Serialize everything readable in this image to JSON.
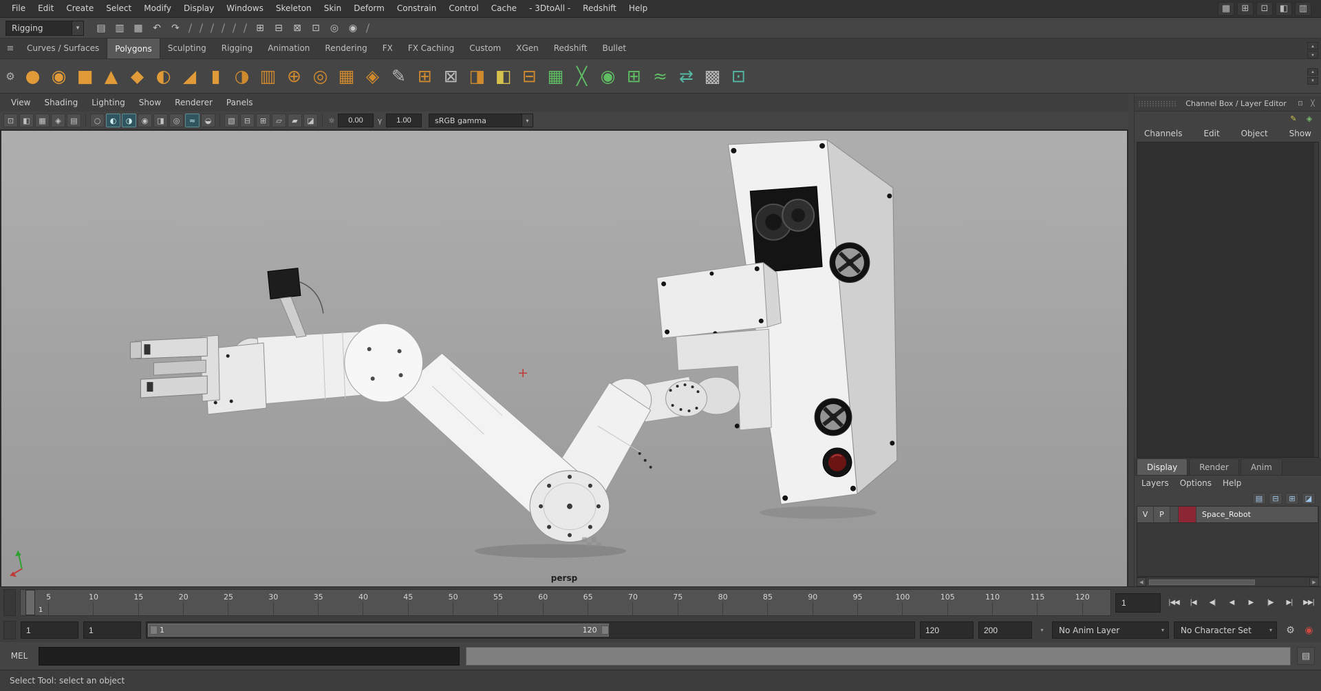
{
  "colors": {
    "shelf_orange": "#e09a38",
    "shelf_green": "#5fbd63",
    "layer_swatch": "#8b2635",
    "viewport_bg": "#a4a4a4",
    "autokey_red": "#cc4842"
  },
  "ui": {
    "chevron_down": "▾",
    "chevron_up": "▴",
    "left_arrow": "◀",
    "right_arrow": "▶",
    "close": "╳",
    "dock": "⊡"
  },
  "menubar": {
    "items": [
      "File",
      "Edit",
      "Create",
      "Select",
      "Modify",
      "Display",
      "Windows",
      "Skeleton",
      "Skin",
      "Deform",
      "Constrain",
      "Control",
      "Cache",
      "- 3DtoAll -",
      "Redshift",
      "Help"
    ],
    "window_icons": [
      {
        "name": "workspace-icon",
        "glyph": "▦"
      },
      {
        "name": "panel-layout-icon",
        "glyph": "⊞"
      },
      {
        "name": "single-pane-icon",
        "glyph": "⊡"
      },
      {
        "name": "outliner-toggle-icon",
        "glyph": "◧"
      },
      {
        "name": "sidebar-toggle-icon",
        "glyph": "▥"
      }
    ]
  },
  "statusline": {
    "menuset": "Rigging",
    "icons": [
      {
        "name": "new-scene-icon",
        "glyph": "▤",
        "kind": "icon"
      },
      {
        "name": "open-scene-icon",
        "glyph": "▥",
        "kind": "icon"
      },
      {
        "name": "save-scene-icon",
        "glyph": "▦",
        "kind": "icon"
      },
      {
        "name": "undo-icon",
        "glyph": "↶",
        "kind": "icon"
      },
      {
        "name": "redo-icon",
        "glyph": "↷",
        "kind": "icon"
      },
      {
        "name": "group-separator",
        "glyph": "∕",
        "kind": "sep"
      },
      {
        "name": "group-separator",
        "glyph": "∕",
        "kind": "sep"
      },
      {
        "name": "group-separator",
        "glyph": "∕",
        "kind": "sep"
      },
      {
        "name": "group-separator",
        "glyph": "∕",
        "kind": "sep"
      },
      {
        "name": "group-separator",
        "glyph": "∕",
        "kind": "sep"
      },
      {
        "name": "group-separator",
        "glyph": "∕",
        "kind": "sep"
      },
      {
        "name": "snap-grid-icon",
        "glyph": "⊞",
        "kind": "icon"
      },
      {
        "name": "snap-curve-icon",
        "glyph": "⊟",
        "kind": "icon"
      },
      {
        "name": "snap-point-icon",
        "glyph": "⊠",
        "kind": "icon"
      },
      {
        "name": "ipr-render-icon",
        "glyph": "⊡",
        "kind": "icon"
      },
      {
        "name": "render-view-icon",
        "glyph": "◎",
        "kind": "icon"
      },
      {
        "name": "render-current-icon",
        "glyph": "◉",
        "kind": "icon"
      },
      {
        "name": "group-separator",
        "glyph": "∕",
        "kind": "sep"
      }
    ]
  },
  "shelf": {
    "tabs": [
      {
        "label": "Curves / Surfaces",
        "state": ""
      },
      {
        "label": "Polygons",
        "state": "active"
      },
      {
        "label": "Sculpting",
        "state": ""
      },
      {
        "label": "Rigging",
        "state": ""
      },
      {
        "label": "Animation",
        "state": ""
      },
      {
        "label": "Rendering",
        "state": ""
      },
      {
        "label": "FX",
        "state": ""
      },
      {
        "label": "FX Caching",
        "state": ""
      },
      {
        "label": "Custom",
        "state": ""
      },
      {
        "label": "XGen",
        "state": ""
      },
      {
        "label": "Redshift",
        "state": ""
      },
      {
        "label": "Bullet",
        "state": ""
      }
    ],
    "icons": [
      {
        "name": "poly-sphere-icon",
        "glyph": "●",
        "tone": "orange"
      },
      {
        "name": "poly-smooth-sphere-icon",
        "glyph": "◉",
        "tone": "orange"
      },
      {
        "name": "poly-cube-icon",
        "glyph": "■",
        "tone": "orange"
      },
      {
        "name": "poly-cone-icon",
        "glyph": "▲",
        "tone": "orange"
      },
      {
        "name": "poly-plane-icon",
        "glyph": "◆",
        "tone": "orange"
      },
      {
        "name": "poly-half-sphere-icon",
        "glyph": "◐",
        "tone": "orange"
      },
      {
        "name": "poly-pyramid-icon",
        "glyph": "◢",
        "tone": "orange"
      },
      {
        "name": "poly-cylinder-icon",
        "glyph": "▮",
        "tone": "orange"
      },
      {
        "name": "sphere-uv-project-icon",
        "glyph": "◑",
        "tone": "orange2"
      },
      {
        "name": "cylinder-stack-icon",
        "glyph": "▥",
        "tone": "orange2"
      },
      {
        "name": "combine-icon",
        "glyph": "⊕",
        "tone": "orange2"
      },
      {
        "name": "booleans-icon",
        "glyph": "◎",
        "tone": "orange2"
      },
      {
        "name": "grid-cube-icon",
        "glyph": "▦",
        "tone": "orange2"
      },
      {
        "name": "platonic-solid-icon",
        "glyph": "◈",
        "tone": "orange2"
      },
      {
        "name": "pencil-curve-icon",
        "glyph": "✎",
        "tone": "gray"
      },
      {
        "name": "extrude-icon",
        "glyph": "⊞",
        "tone": "orange2"
      },
      {
        "name": "multi-component-icon",
        "glyph": "⊠",
        "tone": "gray"
      },
      {
        "name": "bevel-icon",
        "glyph": "◨",
        "tone": "orange2"
      },
      {
        "name": "mirror-icon",
        "glyph": "◧",
        "tone": "yellow"
      },
      {
        "name": "separate-icon",
        "glyph": "⊟",
        "tone": "orange2"
      },
      {
        "name": "quad-draw-icon",
        "glyph": "▦",
        "tone": "green"
      },
      {
        "name": "multi-cut-icon",
        "glyph": "╳",
        "tone": "green"
      },
      {
        "name": "target-weld-icon",
        "glyph": "◉",
        "tone": "green"
      },
      {
        "name": "connect-icon",
        "glyph": "⊞",
        "tone": "green"
      },
      {
        "name": "crease-set-icon",
        "glyph": "≈",
        "tone": "green"
      },
      {
        "name": "symmetry-icon",
        "glyph": "⇄",
        "tone": "teal"
      },
      {
        "name": "uv-checker-icon",
        "glyph": "▩",
        "tone": "gray"
      },
      {
        "name": "sculpt-transfer-icon",
        "glyph": "⊡",
        "tone": "teal"
      }
    ]
  },
  "panel": {
    "menus": [
      "View",
      "Shading",
      "Lighting",
      "Show",
      "Renderer",
      "Panels"
    ],
    "toolbar": {
      "icons_a": [
        {
          "name": "select-camera-icon",
          "glyph": "⊡",
          "state": ""
        },
        {
          "name": "lock-camera-icon",
          "glyph": "◧",
          "state": ""
        },
        {
          "name": "camera-attributes-icon",
          "glyph": "▦",
          "state": ""
        },
        {
          "name": "bookmark-icon",
          "glyph": "◈",
          "state": ""
        },
        {
          "name": "image-plane-icon",
          "glyph": "▤",
          "state": ""
        }
      ],
      "icons_b": [
        {
          "name": "wireframe-icon",
          "glyph": "○",
          "state": ""
        },
        {
          "name": "shaded-icon",
          "glyph": "◐",
          "state": "on"
        },
        {
          "name": "textured-icon",
          "glyph": "◑",
          "state": "on"
        },
        {
          "name": "use-lights-icon",
          "glyph": "◉",
          "state": ""
        },
        {
          "name": "shadows-icon",
          "glyph": "◨",
          "state": ""
        },
        {
          "name": "occlusion-icon",
          "glyph": "◎",
          "state": ""
        },
        {
          "name": "antialias-icon",
          "glyph": "≈",
          "state": "on"
        },
        {
          "name": "depth-of-field-icon",
          "glyph": "◒",
          "state": ""
        }
      ],
      "icons_c": [
        {
          "name": "xray-icon",
          "glyph": "▧",
          "state": ""
        },
        {
          "name": "isolate-select-icon",
          "glyph": "⊟",
          "state": ""
        },
        {
          "name": "grid-toggle-icon",
          "glyph": "⊞",
          "state": ""
        },
        {
          "name": "film-gate-icon",
          "glyph": "▱",
          "state": ""
        },
        {
          "name": "resolution-gate-icon",
          "glyph": "▰",
          "state": ""
        },
        {
          "name": "gate-mask-icon",
          "glyph": "◪",
          "state": ""
        }
      ],
      "exposure_icon": "☼",
      "exposure": "0.00",
      "gamma_icon": "γ",
      "gamma": "1.00",
      "colorspace": "sRGB gamma"
    },
    "camera_label": "persp"
  },
  "channel_box": {
    "title": "Channel Box / Layer Editor",
    "title_icons": [
      {
        "name": "dock-icon",
        "glyph": "⊡"
      },
      {
        "name": "close-icon",
        "glyph": "╳"
      }
    ],
    "mini_icons": [
      {
        "name": "paint-effects-icon",
        "glyph": "✎",
        "tone": "yellow"
      },
      {
        "name": "input-output-icon",
        "glyph": "◈",
        "tone": "green"
      }
    ],
    "menus": [
      "Channels",
      "Edit",
      "Object",
      "Show"
    ]
  },
  "layer_editor": {
    "tabs": [
      {
        "label": "Display",
        "state": "active"
      },
      {
        "label": "Render",
        "state": ""
      },
      {
        "label": "Anim",
        "state": ""
      }
    ],
    "menus": [
      "Layers",
      "Options",
      "Help"
    ],
    "icons": [
      {
        "name": "layer-move-icon",
        "glyph": "▤"
      },
      {
        "name": "empty-layer-icon",
        "glyph": "⊟"
      },
      {
        "name": "new-layer-icon",
        "glyph": "⊞"
      },
      {
        "name": "new-layer-from-selected-icon",
        "glyph": "◪"
      }
    ],
    "layer": {
      "visible": "V",
      "playback": "P",
      "name": "Space_Robot",
      "swatch_color": "#8b2635"
    }
  },
  "timeline": {
    "ticks": [
      "5",
      "10",
      "15",
      "20",
      "25",
      "30",
      "35",
      "40",
      "45",
      "50",
      "55",
      "60",
      "65",
      "70",
      "75",
      "80",
      "85",
      "90",
      "95",
      "100",
      "105",
      "110",
      "115",
      "120"
    ],
    "current_frame": "1",
    "frame_field": "1",
    "playback": [
      {
        "name": "go-to-start-button",
        "glyph": "|◀◀"
      },
      {
        "name": "step-back-frame-button",
        "glyph": "|◀"
      },
      {
        "name": "step-back-key-button",
        "glyph": "◀|"
      },
      {
        "name": "play-backward-button",
        "glyph": "◀"
      },
      {
        "name": "play-forward-button",
        "glyph": "▶"
      },
      {
        "name": "step-forward-key-button",
        "glyph": "|▶"
      },
      {
        "name": "step-forward-frame-button",
        "glyph": "▶|"
      },
      {
        "name": "go-to-end-button",
        "glyph": "▶▶|"
      }
    ]
  },
  "range_bar": {
    "anim_start": "1",
    "playback_start": "1",
    "bar_start": "1",
    "bar_end": "120",
    "playback_end": "120",
    "anim_end": "200",
    "anim_layer": "No Anim Layer",
    "character_set": "No Character Set",
    "icons": [
      {
        "name": "animation-preferences-icon",
        "glyph": "⚙",
        "tone": ""
      },
      {
        "name": "auto-keyframe-icon",
        "glyph": "◉",
        "tone": "red"
      }
    ]
  },
  "command_line": {
    "label": "MEL",
    "input": "",
    "result": "",
    "icon": {
      "name": "script-editor-icon",
      "glyph": "▤"
    }
  },
  "help_line": {
    "text": "Select Tool: select an object"
  }
}
